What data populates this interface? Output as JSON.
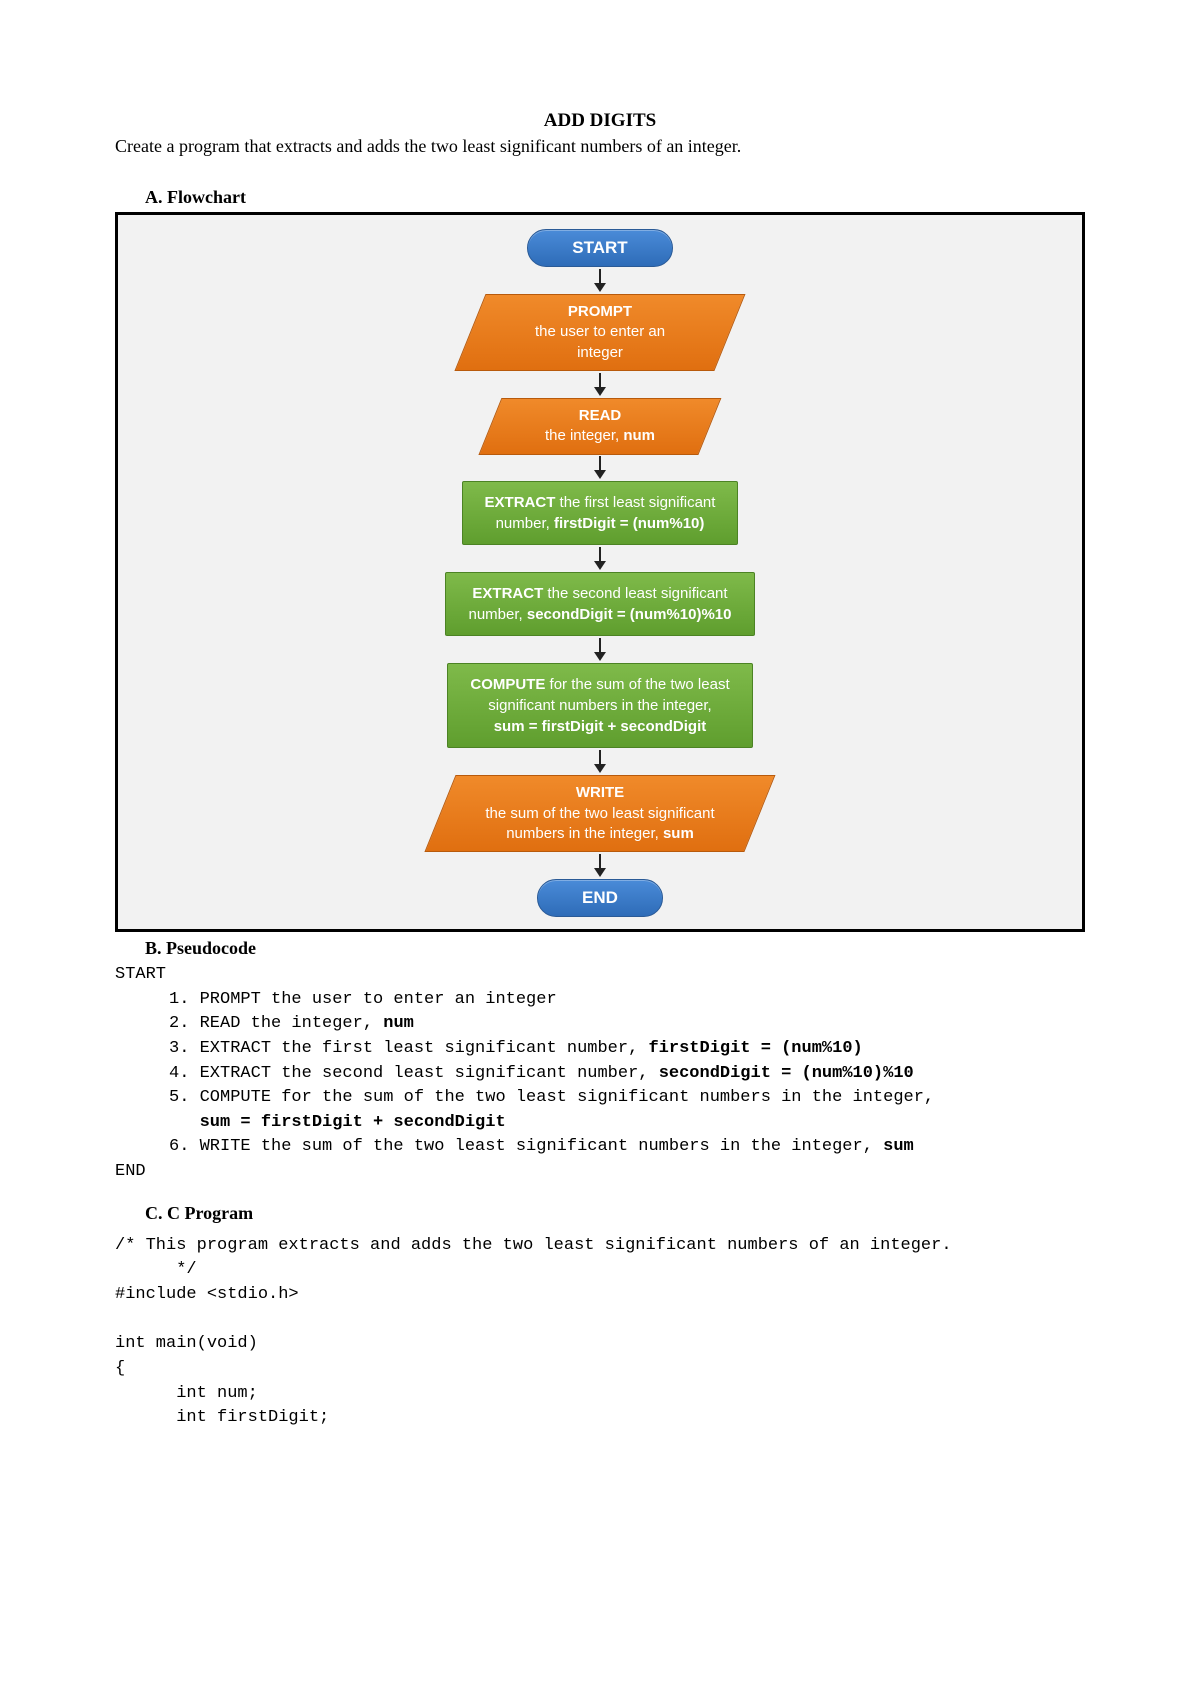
{
  "title": "ADD DIGITS",
  "instruction": "Create a program that extracts and adds the two least significant numbers of an integer.",
  "sections": {
    "a": "A.  Flowchart",
    "b": "B.  Pseudocode",
    "c": "C.  C Program"
  },
  "flow": {
    "start": "START",
    "prompt_title": "PROMPT",
    "prompt_sub": "the user to enter an integer",
    "read_title": "READ",
    "read_sub_pre": "the integer, ",
    "read_sub_b": "num",
    "ext1_a": "EXTRACT",
    "ext1_b": " the first least significant",
    "ext1_c": "number, ",
    "ext1_d": "firstDigit = (num%10)",
    "ext2_a": "EXTRACT",
    "ext2_b": " the second least significant",
    "ext2_c": "number, ",
    "ext2_d": "secondDigit = (num%10)%10",
    "comp_a": "COMPUTE",
    "comp_b": " for the sum of the two least",
    "comp_c": "significant numbers in the integer,",
    "comp_d": "sum = firstDigit + secondDigit",
    "write_title": "WRITE",
    "write_sub1": "the sum of the two least significant",
    "write_sub2_pre": "numbers in the integer, ",
    "write_sub2_b": "sum",
    "end": "END"
  },
  "pseudo": {
    "start": "START",
    "l1": "1. PROMPT the user to enter an integer",
    "l2_a": "2. READ the integer, ",
    "l2_b": "num",
    "l3_a": "3. EXTRACT the first least significant number, ",
    "l3_b": "firstDigit = (num%10)",
    "l4_a": "4. EXTRACT the second least significant number, ",
    "l4_b": "secondDigit = (num%10)%10",
    "l5_a": "5. COMPUTE for the sum of the two least significant numbers in the integer,",
    "l5_b": "   sum = firstDigit + secondDigit",
    "l6_a": "6. WRITE the sum of the two least significant numbers in the integer, ",
    "l6_b": "sum",
    "end": "END"
  },
  "cprog": {
    "l1": "/* This program extracts and adds the two least significant numbers of an integer.",
    "l2": "      */",
    "l3": "#include <stdio.h>",
    "l4": "",
    "l5": "int main(void)",
    "l6": "{",
    "l7": "      int num;",
    "l8": "      int firstDigit;"
  },
  "chart_data": {
    "type": "flowchart",
    "nodes": [
      {
        "id": "start",
        "shape": "terminal",
        "label": "START"
      },
      {
        "id": "prompt",
        "shape": "io",
        "label": "PROMPT the user to enter an integer"
      },
      {
        "id": "read",
        "shape": "io",
        "label": "READ the integer, num"
      },
      {
        "id": "extract1",
        "shape": "process",
        "label": "EXTRACT the first least significant number, firstDigit = (num%10)"
      },
      {
        "id": "extract2",
        "shape": "process",
        "label": "EXTRACT the second least significant number, secondDigit = (num%10)%10"
      },
      {
        "id": "compute",
        "shape": "process",
        "label": "COMPUTE for the sum of the two least significant numbers in the integer, sum = firstDigit + secondDigit"
      },
      {
        "id": "write",
        "shape": "io",
        "label": "WRITE the sum of the two least significant numbers in the integer, sum"
      },
      {
        "id": "end",
        "shape": "terminal",
        "label": "END"
      }
    ],
    "edges": [
      [
        "start",
        "prompt"
      ],
      [
        "prompt",
        "read"
      ],
      [
        "read",
        "extract1"
      ],
      [
        "extract1",
        "extract2"
      ],
      [
        "extract2",
        "compute"
      ],
      [
        "compute",
        "write"
      ],
      [
        "write",
        "end"
      ]
    ]
  }
}
